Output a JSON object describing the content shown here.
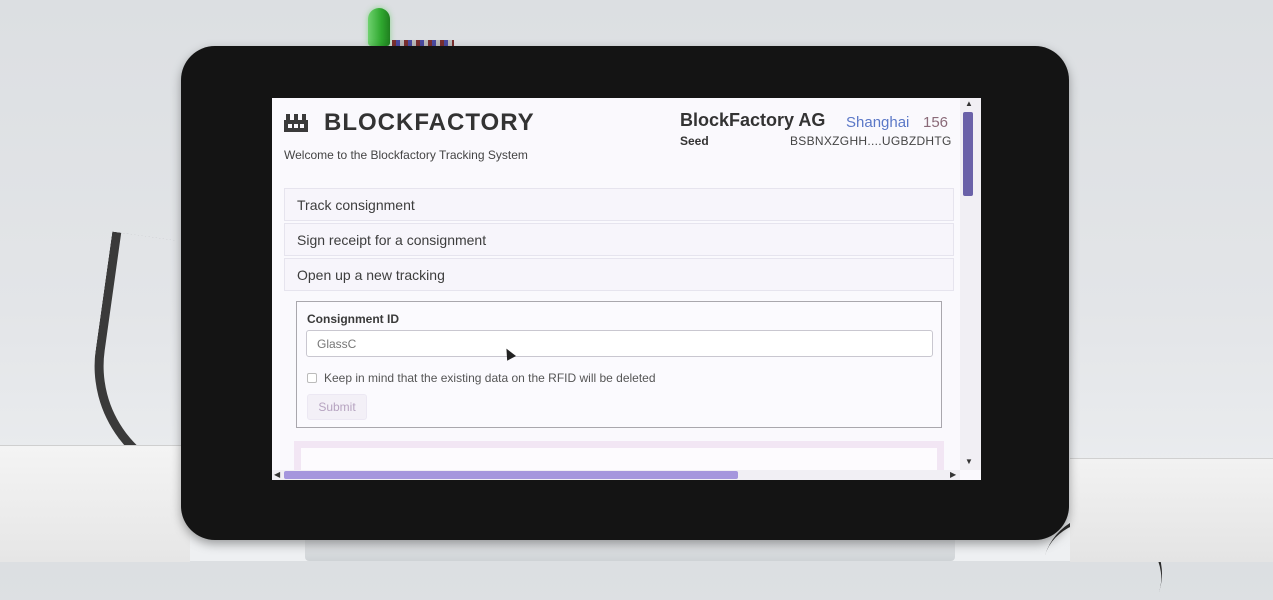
{
  "header": {
    "brand": "BLOCKFACTORY",
    "welcome": "Welcome to the Blockfactory Tracking System",
    "company": "BlockFactory AG",
    "location": "Shanghai",
    "count": "156",
    "seed_label": "Seed",
    "seed_value": "BSBNXZGHH....UGBZDHTG"
  },
  "menu": {
    "items": [
      {
        "label": "Track consignment"
      },
      {
        "label": "Sign receipt for a consignment"
      },
      {
        "label": "Open up a new tracking"
      }
    ]
  },
  "form": {
    "label": "Consignment ID",
    "input_value": "GlassC",
    "checkbox_label": "Keep in mind that the existing data on the RFID will be deleted",
    "checkbox_checked": false,
    "submit_label": "Submit"
  },
  "colors": {
    "accent": "#5b78c7",
    "scrollbar": "#6a61a8",
    "led": "#2fa82f"
  },
  "icons": {
    "logo": "factory-icon",
    "cursor": "mouse-pointer-icon"
  }
}
